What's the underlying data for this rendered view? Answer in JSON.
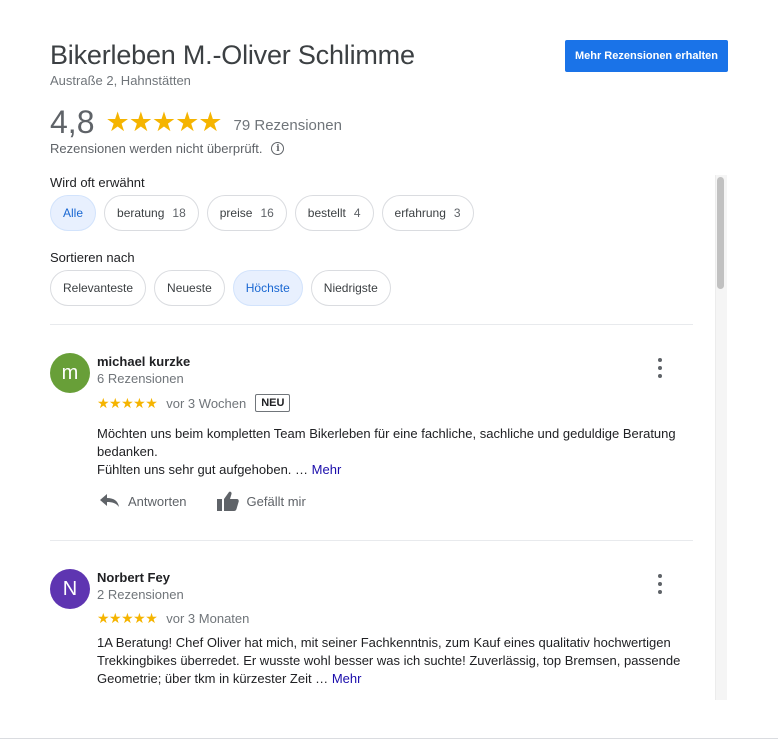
{
  "header": {
    "title": "Bikerleben M.-Oliver Schlimme",
    "address": "Austraße 2, Hahnstätten",
    "more_reviews_button": "Mehr Rezensionen erhalten"
  },
  "summary": {
    "rating": "4,8",
    "stars": "★★★★★",
    "review_count": "79 Rezensionen",
    "disclaimer": "Rezensionen werden nicht überprüft.",
    "info_glyph": "i"
  },
  "mentions": {
    "label": "Wird oft erwähnt",
    "chips": [
      {
        "label": "Alle",
        "count": ""
      },
      {
        "label": "beratung",
        "count": "18"
      },
      {
        "label": "preise",
        "count": "16"
      },
      {
        "label": "bestellt",
        "count": "4"
      },
      {
        "label": "erfahrung",
        "count": "3"
      }
    ]
  },
  "sort": {
    "label": "Sortieren nach",
    "options": [
      "Relevanteste",
      "Neueste",
      "Höchste",
      "Niedrigste"
    ]
  },
  "reviews": [
    {
      "initial": "m",
      "avatar_color": "#689f38",
      "name": "michael kurzke",
      "sub": "6 Rezensionen",
      "stars": "★★★★★",
      "date": "vor 3 Wochen",
      "badge": "NEU",
      "text_line1": "Möchten uns beim kompletten Team Bikerleben für eine fachliche, sachliche und geduldige Beratung bedanken.",
      "text_line2": "Fühlten uns sehr gut aufgehoben. …",
      "more": "Mehr",
      "reply": "Antworten",
      "like": "Gefällt mir"
    },
    {
      "initial": "N",
      "avatar_color": "#5e35b1",
      "name": "Norbert Fey",
      "sub": "2 Rezensionen",
      "stars": "★★★★★",
      "date": "vor 3 Monaten",
      "text": "1A Beratung! Chef Oliver hat mich, mit seiner Fachkenntnis, zum Kauf eines qualitativ hochwertigen Trekkingbikes überredet. Er wusste wohl besser was ich suchte! Zuverlässig, top Bremsen, passende Geometrie; über tkm in kürzester Zeit …",
      "more": "Mehr"
    }
  ],
  "colors": {
    "accent": "#1a73e8",
    "star": "#f5b400",
    "chip_active_bg": "#e8f0fe",
    "link": "#1a0dab"
  }
}
